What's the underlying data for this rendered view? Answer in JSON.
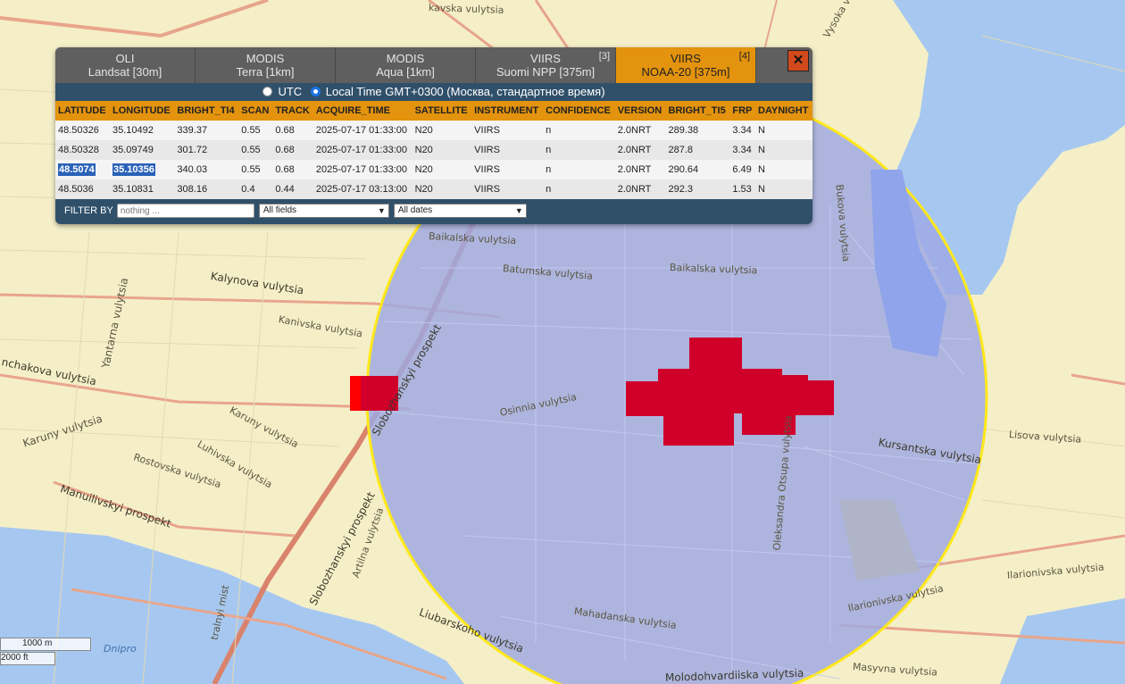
{
  "tabs": [
    {
      "title": "OLI",
      "subtitle": "Landsat [30m]",
      "badge": ""
    },
    {
      "title": "MODIS",
      "subtitle": "Terra [1km]",
      "badge": ""
    },
    {
      "title": "MODIS",
      "subtitle": "Aqua [1km]",
      "badge": ""
    },
    {
      "title": "VIIRS",
      "subtitle": "Suomi NPP [375m]",
      "badge": "[3]"
    },
    {
      "title": "VIIRS",
      "subtitle": "NOAA-20 [375m]",
      "badge": "[4]"
    }
  ],
  "active_tab": 4,
  "close_symbol": "✕",
  "time": {
    "utc_label": "UTC",
    "local_label": "Local Time GMT+0300 (Москва, стандартное время)",
    "selected": "local"
  },
  "table": {
    "headers": [
      "LATITUDE",
      "LONGITUDE",
      "BRIGHT_TI4",
      "SCAN",
      "TRACK",
      "ACQUIRE_TIME",
      "SATELLITE",
      "INSTRUMENT",
      "CONFIDENCE",
      "VERSION",
      "BRIGHT_TI5",
      "FRP",
      "DAYNIGHT"
    ],
    "rows": [
      [
        "48.50326",
        "35.10492",
        "339.37",
        "0.55",
        "0.68",
        "2025-07-17 01:33:00",
        "N20",
        "VIIRS",
        "n",
        "2.0NRT",
        "289.38",
        "3.34",
        "N"
      ],
      [
        "48.50328",
        "35.09749",
        "301.72",
        "0.55",
        "0.68",
        "2025-07-17 01:33:00",
        "N20",
        "VIIRS",
        "n",
        "2.0NRT",
        "287.8",
        "3.34",
        "N"
      ],
      [
        "48.5074",
        "35.10356",
        "340.03",
        "0.55",
        "0.68",
        "2025-07-17 01:33:00",
        "N20",
        "VIIRS",
        "n",
        "2.0NRT",
        "290.64",
        "6.49",
        "N"
      ],
      [
        "48.5036",
        "35.10831",
        "308.16",
        "0.4",
        "0.44",
        "2025-07-17 03:13:00",
        "N20",
        "VIIRS",
        "n",
        "2.0NRT",
        "292.3",
        "1.53",
        "N"
      ]
    ],
    "highlighted_row": 2
  },
  "filter": {
    "label": "FILTER BY",
    "placeholder": "nothing ...",
    "field_select": "All fields",
    "date_select": "All dates"
  },
  "map": {
    "labels": {
      "balkalska1": "Baikalska vulytsia",
      "batumska": "Batumska vulytsia",
      "baikalska2": "Baikalska vulytsia",
      "kalynova": "Kalynova vulytsia",
      "kanivska": "Kanivska vulytsia",
      "yantarna": "Yantarna vulytsia",
      "nchakova": "nchakova vulytsia",
      "karuny1": "Karuny vulytsia",
      "karuny2": "Karuny vulytsia",
      "luhivska": "Luhivska vulytsia",
      "rostovska": "Rostovska vulytsia",
      "manuilivskyi": "Manuilivskyi prospekt",
      "slobozhanskyi1": "Slobozhanskyi prospekt",
      "slobozhanskyi2": "Slobozhanskyi prospekt",
      "osinnia": "Osinnia vulytsia",
      "kursantska": "Kursantska vulytsia",
      "liubarskoho": "Liubarskoho vulytsia",
      "mahadanska": "Mahadanska vulytsia",
      "ilarionivska1": "Ilarionivska vulytsia",
      "ilarionivska2": "Ilarionivska vulytsia",
      "lisova": "Lisova vulytsia",
      "bukova": "Bukova vulytsia",
      "oleksandra": "Oleksandra Otsupa vulytsia",
      "masyvna": "Masyvna vulytsia",
      "vysoka": "Vysoka vulytsia",
      "dnipro": "Dnipro",
      "molodohvardiiska": "Molodohvardiiska vulytsia",
      "artilna": "Artilna vulytsia",
      "kavska": "kavska vulytsia",
      "sentralnyi": "tralnyi mist"
    },
    "scale_metric": "1000 m",
    "scale_imperial": "2000 ft",
    "colors": {
      "radius_fill": "#9ea8e3",
      "radius_stroke": "#ffe81a",
      "hotspot": "#d0002b",
      "hotspot_alt": "#ff0000",
      "water": "#a6c8f0",
      "land": "#f5efc8"
    }
  }
}
